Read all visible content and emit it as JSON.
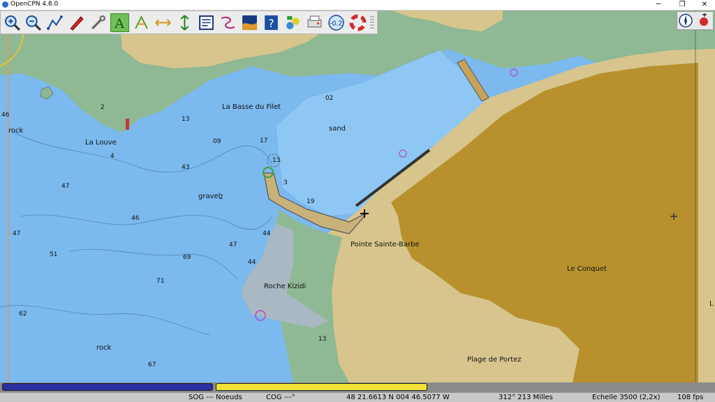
{
  "window": {
    "title": "OpenCPN 4.8.0",
    "minimize": "─",
    "restore": "❐",
    "close": "✕"
  },
  "toolbar": {
    "tools": [
      {
        "name": "zoom-in-icon"
      },
      {
        "name": "zoom-out-icon"
      },
      {
        "name": "route-icon"
      },
      {
        "name": "ship-icon"
      },
      {
        "name": "settings-wrench-icon"
      },
      {
        "name": "ais-icon",
        "active": true
      },
      {
        "name": "currents-icon"
      },
      {
        "name": "measure-icon"
      },
      {
        "name": "depth-icon"
      },
      {
        "name": "route-manager-icon"
      },
      {
        "name": "track-icon"
      },
      {
        "name": "tides-icon"
      },
      {
        "name": "help-icon"
      },
      {
        "name": "plugin-icon"
      },
      {
        "name": "print-icon"
      },
      {
        "name": "overzoom-icon",
        "label": "-0.2"
      },
      {
        "name": "mob-lifebuoy-icon"
      }
    ]
  },
  "map_labels": {
    "la_basse_du_filet": "La Basse du Filet",
    "sand": "sand",
    "rock_left": "rock",
    "la_louve": "La Louve",
    "gravel": "gravel",
    "pointe_sainte_barbe": "Pointe Sainte-Barbe",
    "roche_kizidi": "Roche Kizidi",
    "le_conquet": "Le Conquet",
    "rock_bottom": "rock",
    "plage_de_portez": "Plage de Portez",
    "edge_l": "L"
  },
  "soundings": {
    "s46": "46",
    "s2": "2",
    "s13a": "13",
    "s02": "02",
    "s09": "09",
    "s17": "17",
    "s4": "4",
    "s43": "43",
    "s47a": "47",
    "s13b": "13",
    "s3": "3",
    "s2g": "2",
    "s19": "19",
    "s46b": "46",
    "s47b": "47",
    "s44a": "44",
    "s47c": "47",
    "s51": "51",
    "s69": "69",
    "s44b": "44",
    "s71": "71",
    "s62": "62",
    "s13c": "13",
    "s67": "67"
  },
  "status": {
    "sog": "SOG --- Noeuds",
    "cog": "COG ---°",
    "position": "48 21.6613 N   004 46.5077 W",
    "bearing": "312°  213 Milles",
    "scale": "Echelle 3500 (2,2x)",
    "fps": "108 fps"
  },
  "colors": {
    "sea_deep": "#7bb9ee",
    "sea_shallow": "#88c3f2",
    "land": "#d7c58d",
    "town": "#b8912e",
    "green_zone": "#8fb894",
    "piano_blue": "#2b2fa0",
    "piano_yellow": "#f2e236"
  }
}
